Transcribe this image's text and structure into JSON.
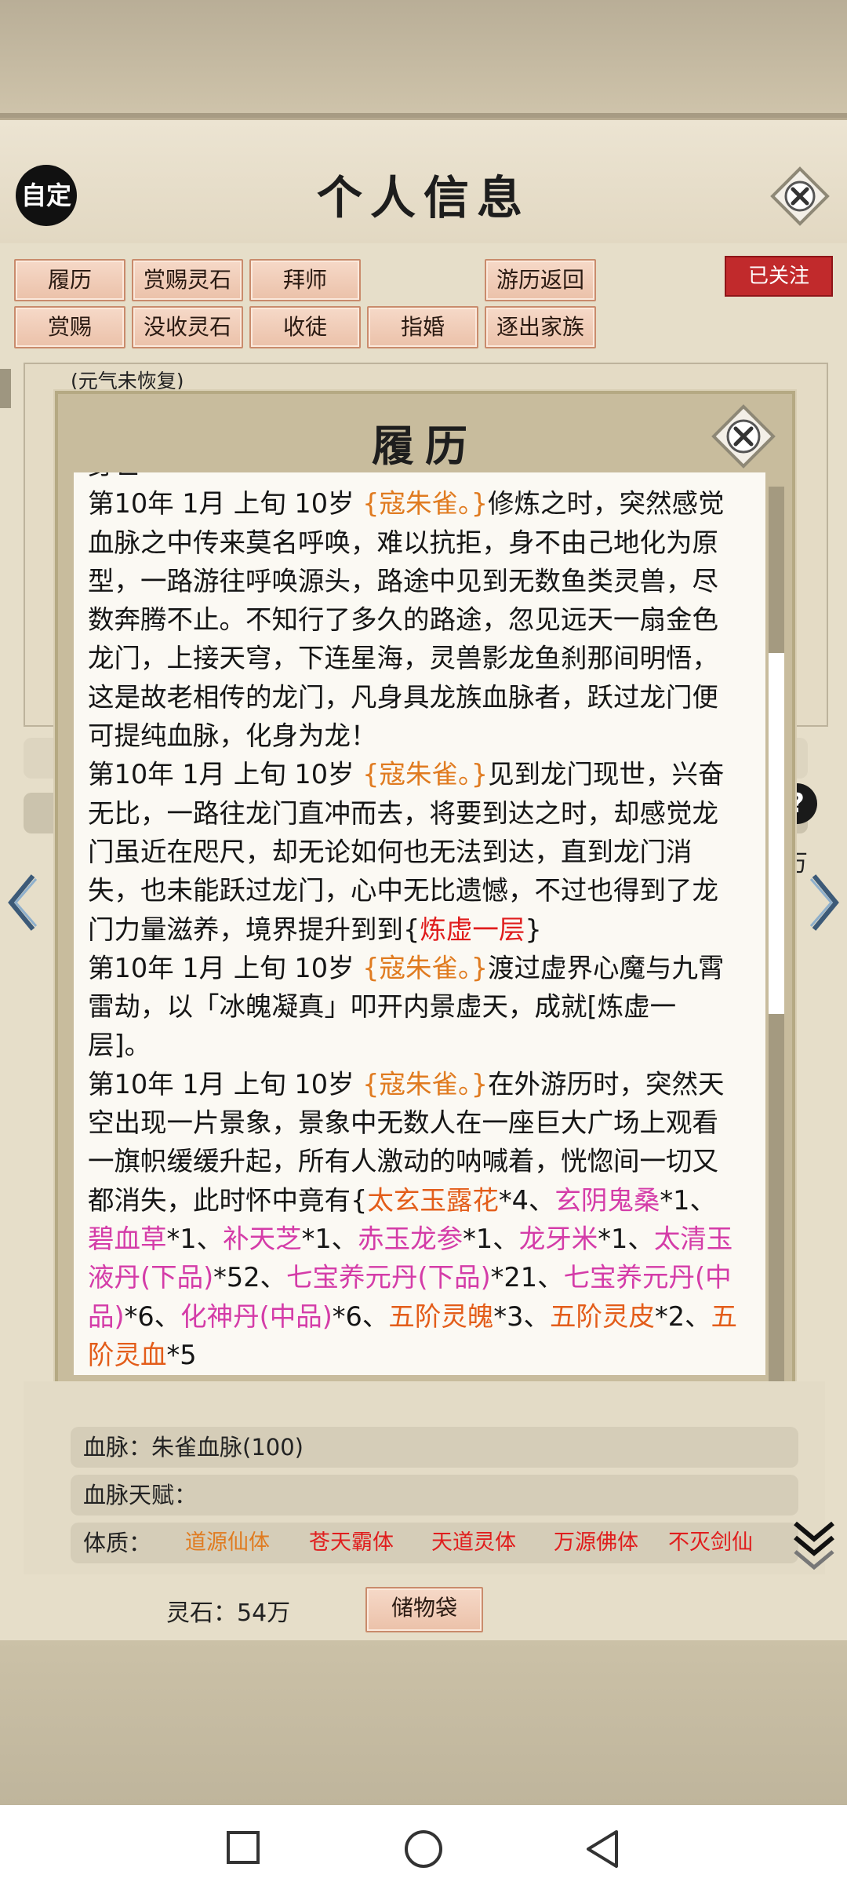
{
  "header": {
    "title": "个人信息",
    "zd_label": "自定",
    "follow_label": "已关注"
  },
  "action_buttons": [
    {
      "label": "履历"
    },
    {
      "label": "赏赐灵石"
    },
    {
      "label": "拜师"
    },
    {
      "label": "游历返回"
    },
    {
      "label": "赏赐"
    },
    {
      "label": "没收灵石"
    },
    {
      "label": "收徒"
    },
    {
      "label": "指婚"
    },
    {
      "label": "逐出家族"
    }
  ],
  "behind": {
    "status_note": "(元气未恢复)",
    "wan": "万"
  },
  "modal": {
    "title": "履历",
    "entries": [
      {
        "date": "第10年 1月 上旬 10岁 ",
        "who": "{寇朱雀。}",
        "text": "修炼之时，突然感觉血脉之中传来莫名呼唤，难以抗拒，身不由己地化为原型，一路游往呼唤源头，路途中见到无数鱼类灵兽，尽数奔腾不止。不知行了多久的路途，忽见远天一扇金色龙门，上接天穹，下连星海，灵兽影龙鱼刹那间明悟，这是故老相传的龙门，凡身具龙族血脉者，跃过龙门便可提纯血脉，化身为龙！"
      },
      {
        "date": "第10年 1月 上旬 10岁 ",
        "who": "{寇朱雀。}",
        "text": "见到龙门现世，兴奋无比，一路往龙门直冲而去，将要到达之时，却感觉龙门虽近在咫尺，却无论如何也无法到达，直到龙门消失，也未能跃过龙门，心中无比遗憾，不过也得到了龙门力量滋养，境界提升到到{",
        "highlight": "炼虚一层",
        "tail": "}"
      },
      {
        "date": "第10年 1月 上旬 10岁 ",
        "who": "{寇朱雀。}",
        "text": "渡过虚界心魔与九霄雷劫，以「冰魄凝真」叩开内景虚天，成就[炼虚一层]。"
      },
      {
        "date": "第10年 1月 上旬 10岁 ",
        "who": "{寇朱雀。}",
        "text": "在外游历时，突然天空出现一片景象，景象中无数人在一座巨大广场上观看一旗帜缓缓升起，所有人激动的呐喊着，恍惚间一切又都消失，此时怀中竟有{",
        "items": [
          {
            "name": "太玄玉露花",
            "qty": "*4",
            "sep": "、"
          },
          {
            "name": "玄阴鬼桑",
            "qty": "*1",
            "sep": "、"
          },
          {
            "name": "碧血草",
            "qty": "*1",
            "sep": "、"
          },
          {
            "name": "补天芝",
            "qty": "*1",
            "sep": "、"
          },
          {
            "name": "赤玉龙参",
            "qty": "*1",
            "sep": "、"
          },
          {
            "name": "龙牙米",
            "qty": "*1",
            "sep": "、"
          },
          {
            "name": "太清玉液丹(下品)",
            "qty": "*52",
            "sep": "、"
          },
          {
            "name": "七宝养元丹(下品)",
            "qty": "*21",
            "sep": "、"
          },
          {
            "name": "七宝养元丹(中品)",
            "qty": "*6",
            "sep": "、"
          },
          {
            "name": "化神丹(中品)",
            "qty": "*6",
            "sep": "、"
          },
          {
            "name": "五阶灵魄",
            "qty": "*3",
            "sep": "、"
          },
          {
            "name": "五阶灵皮",
            "qty": "*2",
            "sep": "、"
          },
          {
            "name": "五阶灵血",
            "qty": "*5",
            "sep": ""
          }
        ]
      }
    ]
  },
  "profile": {
    "bloodline": "血脉：朱雀血脉(100)",
    "bloodline_talent": "血脉天赋：",
    "physique_label": "体质：",
    "physiques": [
      {
        "name": "道源仙体",
        "color": "#e07b20"
      },
      {
        "name": "苍天霸体",
        "color": "#e01d1d"
      },
      {
        "name": "天道灵体",
        "color": "#e01d1d"
      },
      {
        "name": "万源佛体",
        "color": "#e01d1d"
      },
      {
        "name": "不灭剑仙",
        "color": "#e01d1d"
      }
    ]
  },
  "footer": {
    "lingshi": "灵石：54万",
    "bag_label": "储物袋"
  },
  "icons": {
    "close": "close-icon",
    "help": "help-icon",
    "left": "arrow-left-icon",
    "right": "arrow-right-icon",
    "expand": "double-chevron-down-icon",
    "nav": [
      "recents-square-icon",
      "home-circle-icon",
      "back-triangle-icon"
    ]
  }
}
